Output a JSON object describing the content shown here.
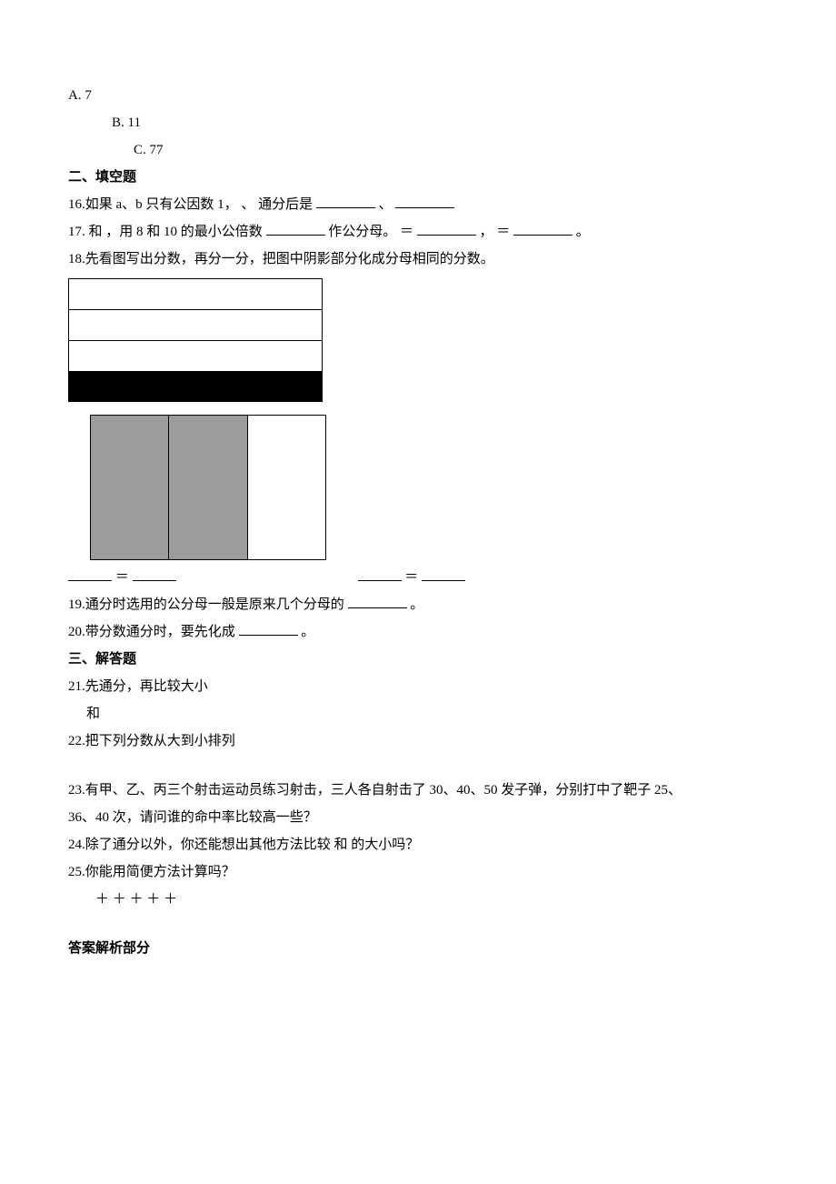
{
  "options": {
    "a": "A.   7",
    "b": "B.   11",
    "c": "C.   77"
  },
  "section2": "二、填空题",
  "q16": {
    "pre": "16.如果 a、b 只有公因数 1，   、   通分后是",
    "sep": "、"
  },
  "q17": {
    "p1": "17.   和   ，用 8 和 10 的最小公倍数",
    "p2": "作公分母。  ＝",
    "p3": "，  ＝",
    "p4": "。"
  },
  "q18": "18.先看图写出分数，再分一分，把图中阴影部分化成分母相同的分数。",
  "q18eq": {
    "eq": "＝"
  },
  "q19": {
    "p1": "19.通分时选用的公分母一般是原来几个分母的",
    "p2": "。"
  },
  "q20": {
    "p1": "20.带分数通分时，要先化成",
    "p2": "。"
  },
  "section3": "三、解答题",
  "q21": {
    "line": "21.先通分，再比较大小",
    "sub": "和"
  },
  "q22": "22.把下列分数从大到小排列",
  "q23": {
    "l1": "23.有甲、乙、丙三个射击运动员练习射击，三人各自射击了 30、40、50 发子弹，分别打中了靶子 25、",
    "l2": "36、40 次，请问谁的命中率比较高一些？"
  },
  "q24": "24.除了通分以外，你还能想出其他方法比较    和    的大小吗？",
  "q25": {
    "line": "25.你能用简便方法计算吗？",
    "sub": "＋    ＋    ＋    ＋    ＋"
  },
  "answer_section": "答案解析部分"
}
